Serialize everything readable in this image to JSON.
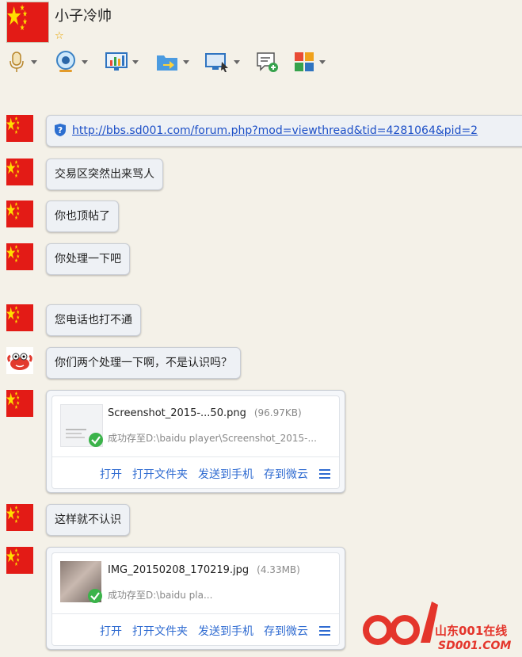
{
  "header": {
    "title": "小子冷帅",
    "status_star": "☆"
  },
  "toolbar": {
    "items": [
      "microphone-icon",
      "video-icon",
      "screen-share-icon",
      "send-file-icon",
      "remote-desktop-icon",
      "new-message-icon",
      "apps-icon"
    ]
  },
  "messages": [
    {
      "type": "link",
      "text": "http://bbs.sd001.com/forum.php?mod=viewthread&tid=4281064&pid=2"
    },
    {
      "type": "text",
      "text": "交易区突然出来骂人"
    },
    {
      "type": "text",
      "text": "你也顶帖了"
    },
    {
      "type": "text",
      "text": "你处理一下吧"
    },
    {
      "type": "text",
      "text": "您电话也打不通"
    },
    {
      "type": "text",
      "text": "你们两个处理一下啊，不是认识吗？"
    },
    {
      "type": "file",
      "name": "Screenshot_2015-...50.png",
      "size": "(96.97KB)",
      "path": "成功存至D:\\baidu player\\Screenshot_2015-..."
    },
    {
      "type": "text",
      "text": "这样就不认识"
    },
    {
      "type": "file",
      "name": "IMG_20150208_170219.jpg",
      "size": "(4.33MB)",
      "path": "成功存至D:\\baidu pla..."
    }
  ],
  "file_actions": {
    "open": "打开",
    "open_folder": "打开文件夹",
    "send_phone": "发送到手机",
    "save_cloud": "存到微云"
  },
  "watermark": {
    "site_cn": "山东001在线",
    "site_en": "SD001.COM"
  },
  "colors": {
    "background": "#f4f1e8",
    "bubble": "#eef1f5",
    "link": "#1c4fc7",
    "action": "#2f6bd1",
    "flag_red": "#e31b16",
    "flag_star": "#ffde00"
  }
}
